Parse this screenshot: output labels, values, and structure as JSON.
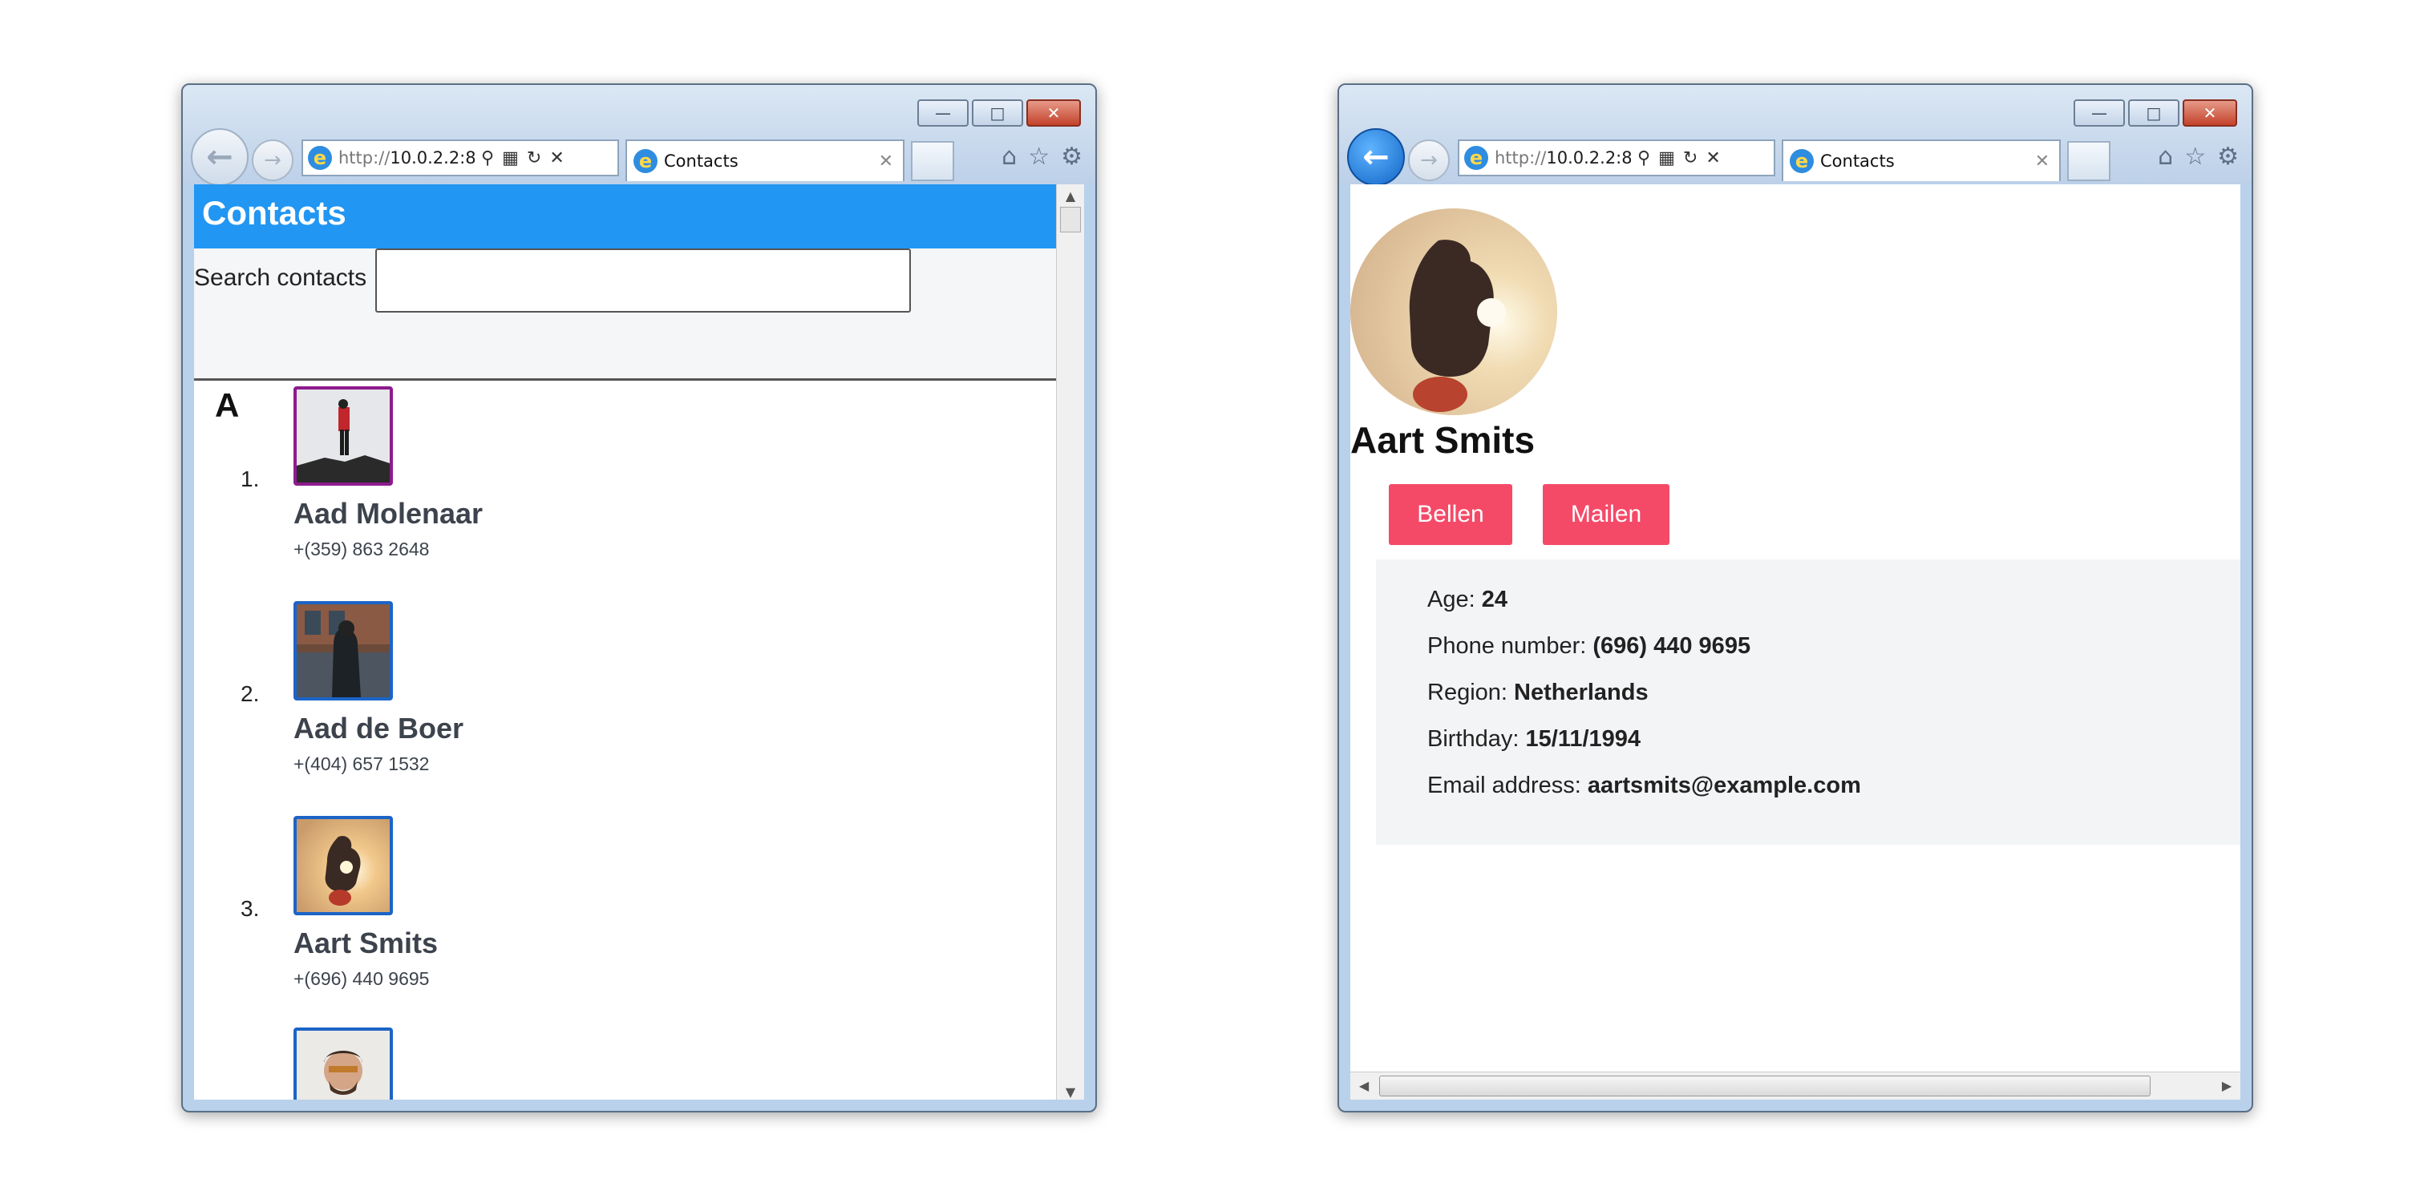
{
  "left_window": {
    "url_proto": "http://",
    "url_rest": "10.0.2.2:8(",
    "tab_title": "Contacts",
    "app_title": "Contacts",
    "search_label": "Search contacts",
    "search_value": "",
    "group_letter": "A",
    "contacts": [
      {
        "number": "1.",
        "name": "Aad Molenaar",
        "phone": "+(359) 863 2648"
      },
      {
        "number": "2.",
        "name": "Aad de Boer",
        "phone": "+(404) 657 1532"
      },
      {
        "number": "3.",
        "name": "Aart Smits",
        "phone": "+(696) 440 9695"
      }
    ]
  },
  "right_window": {
    "url_proto": "http://",
    "url_rest": "10.0.2.2:8(",
    "tab_title": "Contacts",
    "contact_name": "Aart Smits",
    "call_button": "Bellen",
    "mail_button": "Mailen",
    "details": [
      {
        "label": "Age: ",
        "value": "24"
      },
      {
        "label": "Phone number: ",
        "value": "(696) 440 9695"
      },
      {
        "label": "Region: ",
        "value": "Netherlands"
      },
      {
        "label": "Birthday: ",
        "value": "15/11/1994"
      },
      {
        "label": "Email address: ",
        "value": "aartsmits@example.com"
      }
    ]
  },
  "icons": {
    "back": "back-arrow-icon",
    "forward": "forward-arrow-icon",
    "ie": "ie-logo-icon",
    "home": "home-icon",
    "favorites": "star-icon",
    "settings": "gear-icon"
  },
  "colors": {
    "header_blue": "#2196f3",
    "button_red": "#f44a68",
    "selected_border": "#8e1b8e",
    "photo_border": "#1c64c7"
  }
}
